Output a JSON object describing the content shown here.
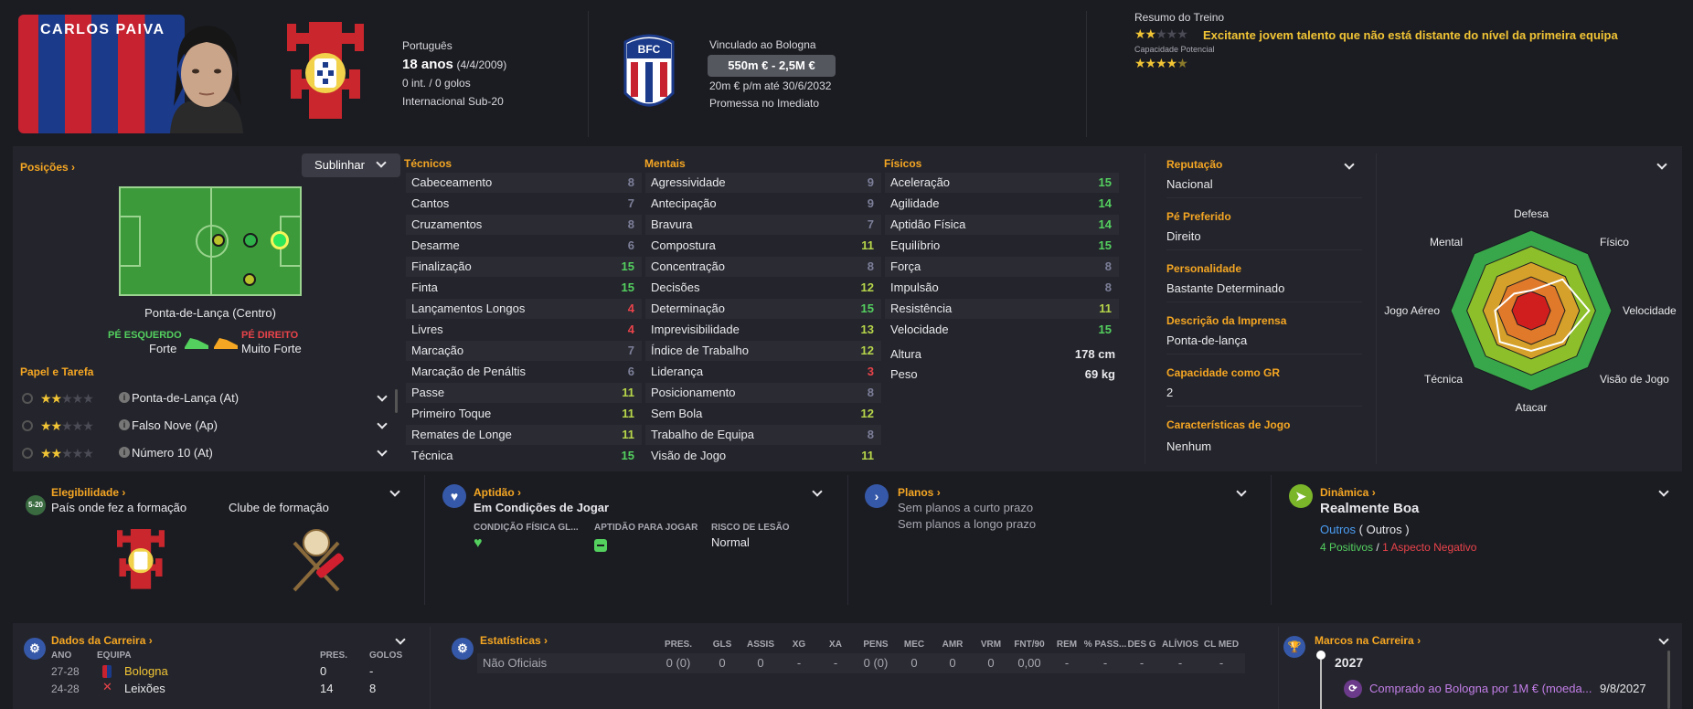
{
  "header": {
    "player_name": "CARLOS PAIVA",
    "nationality": "Português",
    "age": "18 anos",
    "dob": "(4/4/2009)",
    "caps": "0 int. / 0 golos",
    "intl": "Internacional Sub-20",
    "club_contract": "Vinculado ao Bologna",
    "value": "550m € - 2,5M €",
    "wage": "20m € p/m até 30/6/2032",
    "status": "Promessa no Imediato",
    "training_title": "Resumo do Treino",
    "training_text": "Excitante jovem talento que não está distante do nível da primeira equipa",
    "potential_label": "Capacidade Potencial"
  },
  "positions": {
    "title": "Posições",
    "highlight_btn": "Sublinhar",
    "position_name": "Ponta-de-Lança (Centro)",
    "left_foot_label": "PÉ ESQUERDO",
    "left_foot_value": "Forte",
    "right_foot_label": "PÉ DIREITO",
    "right_foot_value": "Muito Forte",
    "roles_title": "Papel e Tarefa",
    "roles": [
      {
        "name": "Ponta-de-Lança (At)",
        "stars": 2
      },
      {
        "name": "Falso Nove (Ap)",
        "stars": 2
      },
      {
        "name": "Número 10 (At)",
        "stars": 2
      }
    ]
  },
  "attributes": {
    "technical_title": "Técnicos",
    "mental_title": "Mentais",
    "physical_title": "Físicos",
    "technical": [
      {
        "name": "Cabeceamento",
        "value": "8",
        "color": "#7d7f99"
      },
      {
        "name": "Cantos",
        "value": "7",
        "color": "#7d7f99"
      },
      {
        "name": "Cruzamentos",
        "value": "8",
        "color": "#7d7f99"
      },
      {
        "name": "Desarme",
        "value": "6",
        "color": "#7d7f99"
      },
      {
        "name": "Finalização",
        "value": "15",
        "color": "#54d05f"
      },
      {
        "name": "Finta",
        "value": "15",
        "color": "#54d05f"
      },
      {
        "name": "Lançamentos Longos",
        "value": "4",
        "color": "#e9434a"
      },
      {
        "name": "Livres",
        "value": "4",
        "color": "#e9434a"
      },
      {
        "name": "Marcação",
        "value": "7",
        "color": "#7d7f99"
      },
      {
        "name": "Marcação de Penáltis",
        "value": "6",
        "color": "#7d7f99"
      },
      {
        "name": "Passe",
        "value": "11",
        "color": "#b7d64a"
      },
      {
        "name": "Primeiro Toque",
        "value": "11",
        "color": "#b7d64a"
      },
      {
        "name": "Remates de Longe",
        "value": "11",
        "color": "#b7d64a"
      },
      {
        "name": "Técnica",
        "value": "15",
        "color": "#54d05f"
      }
    ],
    "mental": [
      {
        "name": "Agressividade",
        "value": "9",
        "color": "#7d7f99"
      },
      {
        "name": "Antecipação",
        "value": "9",
        "color": "#7d7f99"
      },
      {
        "name": "Bravura",
        "value": "7",
        "color": "#7d7f99"
      },
      {
        "name": "Compostura",
        "value": "11",
        "color": "#b7d64a"
      },
      {
        "name": "Concentração",
        "value": "8",
        "color": "#7d7f99"
      },
      {
        "name": "Decisões",
        "value": "12",
        "color": "#b7d64a"
      },
      {
        "name": "Determinação",
        "value": "15",
        "color": "#54d05f"
      },
      {
        "name": "Imprevisibilidade",
        "value": "13",
        "color": "#b7d64a"
      },
      {
        "name": "Índice de Trabalho",
        "value": "12",
        "color": "#b7d64a"
      },
      {
        "name": "Liderança",
        "value": "3",
        "color": "#e9434a"
      },
      {
        "name": "Posicionamento",
        "value": "8",
        "color": "#7d7f99"
      },
      {
        "name": "Sem Bola",
        "value": "12",
        "color": "#b7d64a"
      },
      {
        "name": "Trabalho de Equipa",
        "value": "8",
        "color": "#7d7f99"
      },
      {
        "name": "Visão de Jogo",
        "value": "11",
        "color": "#b7d64a"
      }
    ],
    "physical": [
      {
        "name": "Aceleração",
        "value": "15",
        "color": "#54d05f"
      },
      {
        "name": "Agilidade",
        "value": "14",
        "color": "#54d05f"
      },
      {
        "name": "Aptidão Física",
        "value": "14",
        "color": "#54d05f"
      },
      {
        "name": "Equilíbrio",
        "value": "15",
        "color": "#54d05f"
      },
      {
        "name": "Força",
        "value": "8",
        "color": "#7d7f99"
      },
      {
        "name": "Impulsão",
        "value": "8",
        "color": "#7d7f99"
      },
      {
        "name": "Resistência",
        "value": "11",
        "color": "#b7d64a"
      },
      {
        "name": "Velocidade",
        "value": "15",
        "color": "#54d05f"
      }
    ],
    "height_label": "Altura",
    "height": "178 cm",
    "weight_label": "Peso",
    "weight": "69 kg"
  },
  "info": {
    "reputation_label": "Reputação",
    "reputation": "Nacional",
    "foot_label": "Pé Preferido",
    "foot": "Direito",
    "personality_label": "Personalidade",
    "personality": "Bastante Determinado",
    "press_label": "Descrição da Imprensa",
    "press": "Ponta-de-lança",
    "gk_label": "Capacidade como GR",
    "gk": "2",
    "traits_label": "Características de Jogo",
    "traits": "Nenhum"
  },
  "radar": {
    "labels": [
      "Defesa",
      "Físico",
      "Velocidade",
      "Visão de Jogo",
      "Atacar",
      "Técnica",
      "Jogo Aéreo",
      "Mental"
    ],
    "values": [
      0.25,
      0.55,
      0.72,
      0.55,
      0.5,
      0.55,
      0.45,
      0.3
    ]
  },
  "eligibility": {
    "title": "Elegibilidade",
    "badge": "5-20",
    "country_label": "País onde fez a formação",
    "club_label": "Clube de formação"
  },
  "fitness": {
    "title": "Aptidão",
    "status": "Em Condições de Jogar",
    "col1": "CONDIÇÃO FÍSICA GL...",
    "col2": "APTIDÃO PARA JOGAR",
    "col3": "RISCO DE LESÃO",
    "risk": "Normal"
  },
  "plans": {
    "title": "Planos",
    "short": "Sem planos a curto prazo",
    "long": "Sem planos a longo prazo"
  },
  "dynamics": {
    "title": "Dinâmica",
    "value": "Realmente Boa",
    "others": "Outros",
    "others_paren": "( Outros )",
    "positives": "4 Positivos",
    "slash": "/",
    "negatives": "1 Aspecto Negativo"
  },
  "career": {
    "title": "Dados da Carreira",
    "headers": [
      "ANO",
      "EQUIPA",
      "PRES.",
      "GOLOS"
    ],
    "rows": [
      {
        "year": "27-28",
        "team": "Bologna",
        "apps": "0",
        "goals": "-"
      },
      {
        "year": "24-28",
        "team": "Leixões",
        "apps": "14",
        "goals": "8"
      }
    ]
  },
  "stats": {
    "title": "Estatísticas",
    "headers": [
      "PRES.",
      "GLS",
      "ASSIS",
      "XG",
      "XA",
      "PENS",
      "MEC",
      "AMR",
      "VRM",
      "FNT/90",
      "REM",
      "% PASS...",
      "DES G",
      "ALÍVIOS",
      "CL MED"
    ],
    "row_label": "Não Oficiais",
    "row": [
      "0 (0)",
      "0",
      "0",
      "-",
      "-",
      "0 (0)",
      "0",
      "0",
      "0",
      "0,00",
      "-",
      "-",
      "-",
      "-",
      "-"
    ]
  },
  "milestones": {
    "title": "Marcos na Carreira",
    "year": "2027",
    "event": "Comprado ao Bologna por 1M € (moeda...",
    "date": "9/8/2027"
  }
}
